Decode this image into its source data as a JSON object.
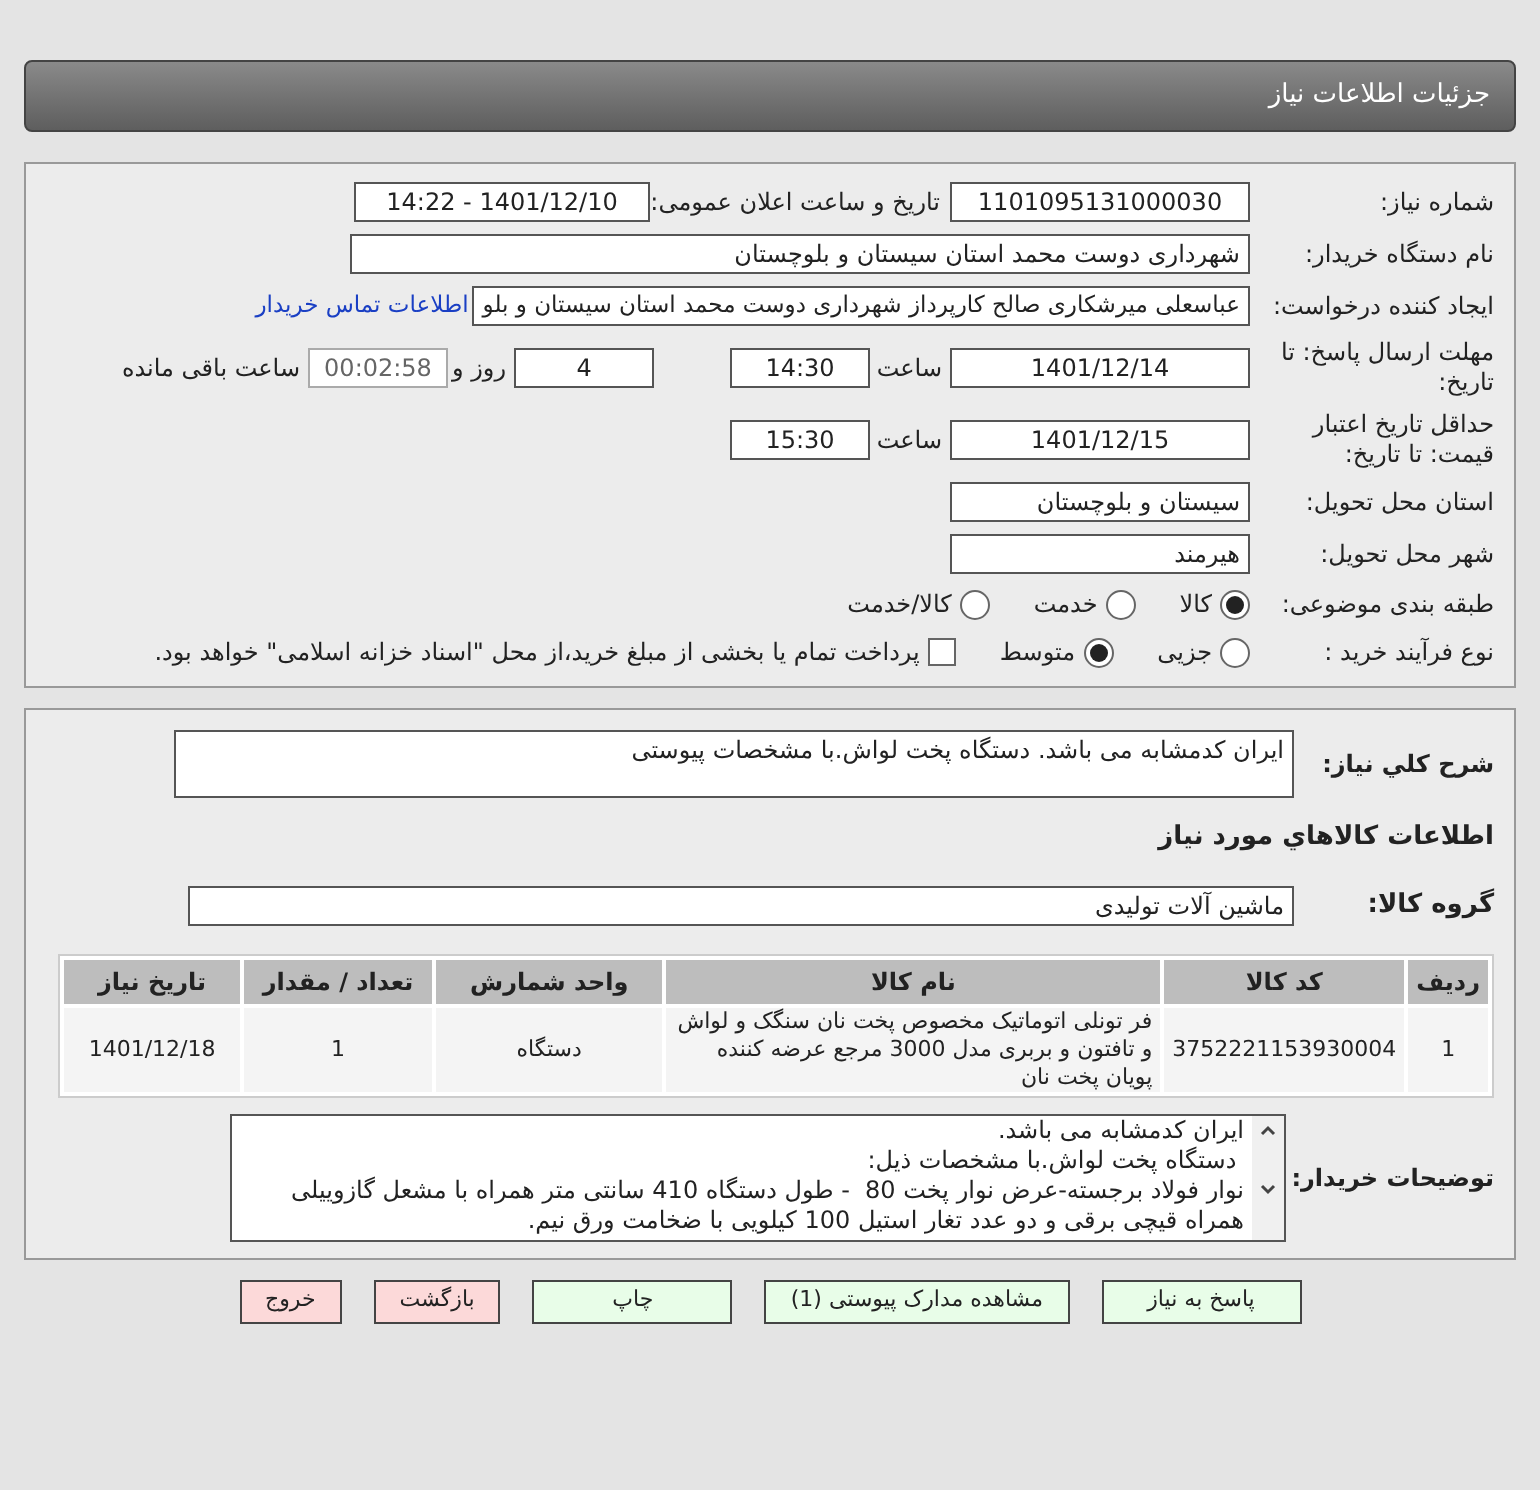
{
  "header": {
    "title": "جزئیات اطلاعات نیاز"
  },
  "details": {
    "need_number": {
      "label": "شماره نیاز:",
      "value": "1101095131000030"
    },
    "announce": {
      "label": "تاریخ و ساعت اعلان عمومی:",
      "value": "1401/12/10 - 14:22"
    },
    "buyer": {
      "label": "نام دستگاه خریدار:",
      "value": "شهرداری دوست محمد استان سیستان و بلوچستان"
    },
    "creator": {
      "label": "ایجاد کننده درخواست:",
      "value": "عباسعلی میرشکاری صالح کارپرداز شهرداری دوست محمد استان سیستان و بلو",
      "link": "اطلاعات تماس خریدار"
    },
    "deadline": {
      "label": "مهلت ارسال پاسخ: تا تاریخ:",
      "date": "1401/12/14",
      "time_label": "ساعت",
      "time": "14:30",
      "days": "4",
      "days_label": "روز و",
      "remaining": "00:02:58",
      "remaining_label": "ساعت باقی مانده"
    },
    "validity": {
      "label": "حداقل تاریخ اعتبار قیمت: تا تاریخ:",
      "date": "1401/12/15",
      "time_label": "ساعت",
      "time": "15:30"
    },
    "province": {
      "label": "استان محل تحویل:",
      "value": "سیستان و بلوچستان"
    },
    "city": {
      "label": "شهر محل تحویل:",
      "value": "هیرمند"
    },
    "category": {
      "label": "طبقه بندی موضوعی:",
      "options": [
        {
          "label": "کالا",
          "selected": true
        },
        {
          "label": "خدمت",
          "selected": false
        },
        {
          "label": "کالا/خدمت",
          "selected": false
        }
      ]
    },
    "process": {
      "label": "نوع فرآیند خرید :",
      "options": [
        {
          "label": "جزیی",
          "selected": false
        },
        {
          "label": "متوسط",
          "selected": true
        }
      ],
      "treasury": {
        "checked": false,
        "label": "پرداخت تمام یا بخشی از مبلغ خرید،از محل \"اسناد خزانه اسلامی\" خواهد بود."
      }
    }
  },
  "summary": {
    "label": "شرح کلي نياز:",
    "value": "ايران كدمشابه می باشد. دستگاه پخت لواش.با مشخصات پیوستی"
  },
  "goods_title": "اطلاعات کالاهاي مورد نياز",
  "goods_group": {
    "label": "گروه کالا:",
    "value": "ماشین آلات تولیدی"
  },
  "table": {
    "columns": [
      "ردیف",
      "کد کالا",
      "نام کالا",
      "واحد شمارش",
      "تعداد / مقدار",
      "تاریخ نیاز"
    ],
    "rows": [
      [
        "1",
        "3752221153930004",
        "فر تونلی اتوماتیک مخصوص پخت نان سنگک و لواش و تافتون و بربری مدل 3000 مرجع عرضه کننده پویان پخت نان",
        "دستگاه",
        "1",
        "1401/12/18"
      ]
    ]
  },
  "buyer_notes": {
    "label": "توضیحات خریدار:",
    "value": "ایران کدمشابه می باشد.\n دستگاه پخت لواش.با مشخصات ذیل:\nنوار فولاد برجسته-عرض نوار پخت 80  - طول دستگاه 410 سانتی متر همراه با مشعل گازوییلی همراه قیچی برقی و دو عدد تغار استیل 100 کیلویی با ضخامت ورق نیم."
  },
  "buttons": [
    {
      "label": "پاسخ به نیاز",
      "kind": "normal"
    },
    {
      "label": "مشاهده مدارک پیوستی (1)",
      "kind": "normal"
    },
    {
      "label": "چاپ",
      "kind": "normal"
    },
    {
      "label": "بازگشت",
      "kind": "danger"
    },
    {
      "label": "خروج",
      "kind": "danger"
    }
  ]
}
